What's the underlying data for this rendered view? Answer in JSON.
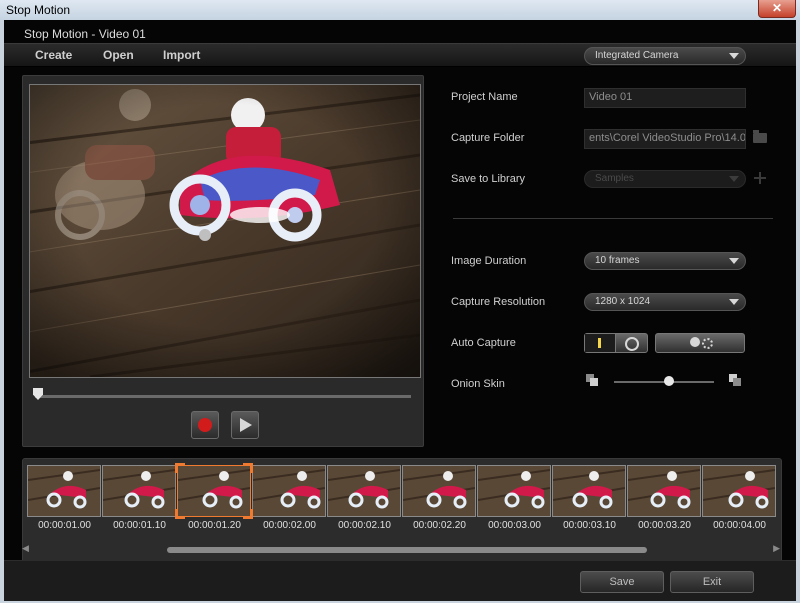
{
  "window": {
    "title": "Stop Motion",
    "close_glyph": "✕"
  },
  "app": {
    "subtitle": "Stop Motion - Video 01"
  },
  "menu": {
    "items": [
      "Create",
      "Open",
      "Import"
    ]
  },
  "camera": {
    "selected": "Integrated Camera"
  },
  "form": {
    "project_name_label": "Project Name",
    "project_name_value": "Video 01",
    "capture_folder_label": "Capture Folder",
    "capture_folder_value": "ents\\Corel VideoStudio Pro\\14.0\\",
    "save_library_label": "Save to Library",
    "save_library_value": "Samples",
    "image_duration_label": "Image Duration",
    "image_duration_value": "10 frames",
    "capture_resolution_label": "Capture Resolution",
    "capture_resolution_value": "1280 x 1024",
    "auto_capture_label": "Auto Capture",
    "onion_skin_label": "Onion Skin",
    "onion_skin_level": 0.55
  },
  "playback": {
    "position": 0.0
  },
  "timeline": {
    "timecodes": [
      "00:00:01.00",
      "00:00:01.10",
      "00:00:01.20",
      "00:00:02.00",
      "00:00:02.10",
      "00:00:02.20",
      "00:00:03.00",
      "00:00:03.10",
      "00:00:03.20",
      "00:00:04.00"
    ],
    "selected_index": 2
  },
  "scroll_arrows": {
    "left": "◀",
    "right": "▶"
  },
  "buttons": {
    "save": "Save",
    "exit": "Exit"
  },
  "colors": {
    "accent_selection": "#f07a30",
    "record": "#d21c1c"
  }
}
